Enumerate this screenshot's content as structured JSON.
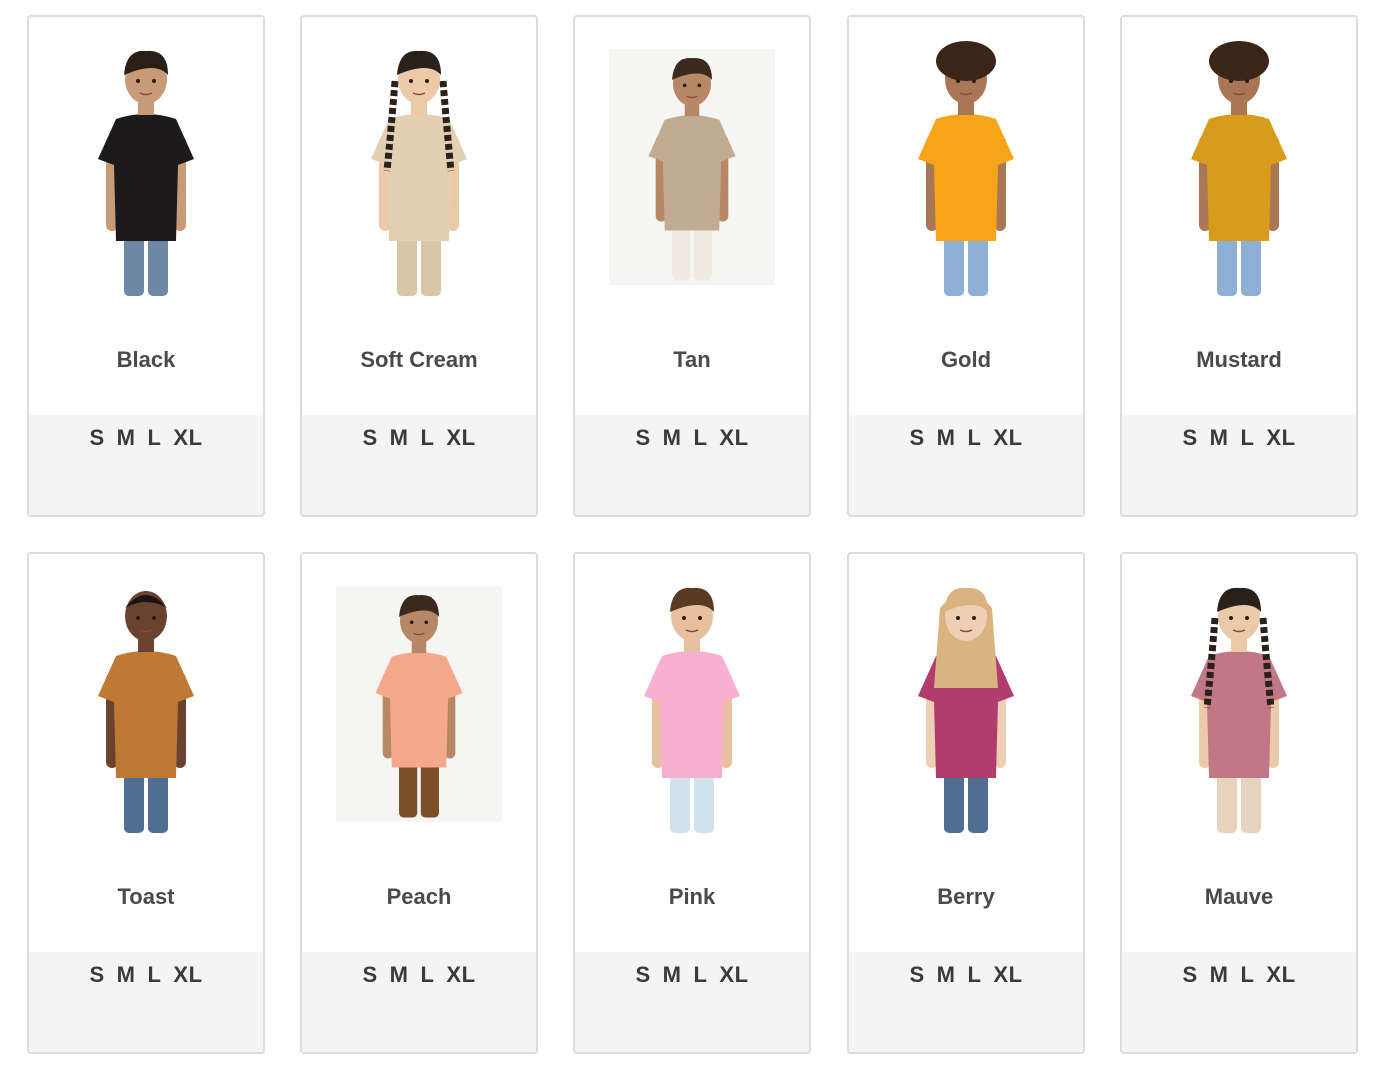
{
  "products": [
    {
      "color": "Black",
      "sizes": [
        "S",
        "M",
        "L",
        "XL"
      ],
      "shirt_color": "#1c1a1a",
      "hair_color": "#2a1f17",
      "skin": "#c79a78",
      "pants_color": "#6f88a6",
      "photo_bg": false,
      "hair": "short"
    },
    {
      "color": "Soft Cream",
      "sizes": [
        "S",
        "M",
        "L",
        "XL"
      ],
      "shirt_color": "#e3cfb2",
      "hair_color": "#2b211b",
      "skin": "#ecc9a8",
      "pants_color": "#d9c4a6",
      "photo_bg": false,
      "hair": "braids"
    },
    {
      "color": "Tan",
      "sizes": [
        "S",
        "M",
        "L",
        "XL"
      ],
      "shirt_color": "#c2ab93",
      "hair_color": "#3a2a1e",
      "skin": "#b88866",
      "pants_color": "#eeeae0",
      "photo_bg": true,
      "hair": "short"
    },
    {
      "color": "Gold",
      "sizes": [
        "S",
        "M",
        "L",
        "XL"
      ],
      "shirt_color": "#f6a519",
      "hair_color": "#3a2618",
      "skin": "#a97755",
      "pants_color": "#8fb0d6",
      "photo_bg": false,
      "hair": "curly"
    },
    {
      "color": "Mustard",
      "sizes": [
        "S",
        "M",
        "L",
        "XL"
      ],
      "shirt_color": "#d79c1b",
      "hair_color": "#3a2618",
      "skin": "#a97755",
      "pants_color": "#8fb0d6",
      "photo_bg": false,
      "hair": "curly"
    },
    {
      "color": "Toast",
      "sizes": [
        "S",
        "M",
        "L",
        "XL"
      ],
      "shirt_color": "#c07835",
      "hair_color": "#1c1410",
      "skin": "#6a4330",
      "pants_color": "#4e6e92",
      "photo_bg": false,
      "hair": "braids-short"
    },
    {
      "color": "Peach",
      "sizes": [
        "S",
        "M",
        "L",
        "XL"
      ],
      "shirt_color": "#f5a98a",
      "hair_color": "#3a2a1e",
      "skin": "#b88866",
      "pants_color": "#7a4f2a",
      "photo_bg": true,
      "hair": "short"
    },
    {
      "color": "Pink",
      "sizes": [
        "S",
        "M",
        "L",
        "XL"
      ],
      "shirt_color": "#f9afd0",
      "hair_color": "#5b3a22",
      "skin": "#e7c0a0",
      "pants_color": "#cfe2ee",
      "photo_bg": false,
      "hair": "short"
    },
    {
      "color": "Berry",
      "sizes": [
        "S",
        "M",
        "L",
        "XL"
      ],
      "shirt_color": "#b13d6e",
      "hair_color": "#d9b480",
      "skin": "#efcfb3",
      "pants_color": "#4e6e92",
      "photo_bg": false,
      "hair": "long"
    },
    {
      "color": "Mauve",
      "sizes": [
        "S",
        "M",
        "L",
        "XL"
      ],
      "shirt_color": "#c27786",
      "hair_color": "#2b211b",
      "skin": "#ecc9a8",
      "pants_color": "#e8d3bf",
      "photo_bg": false,
      "hair": "braids"
    }
  ]
}
